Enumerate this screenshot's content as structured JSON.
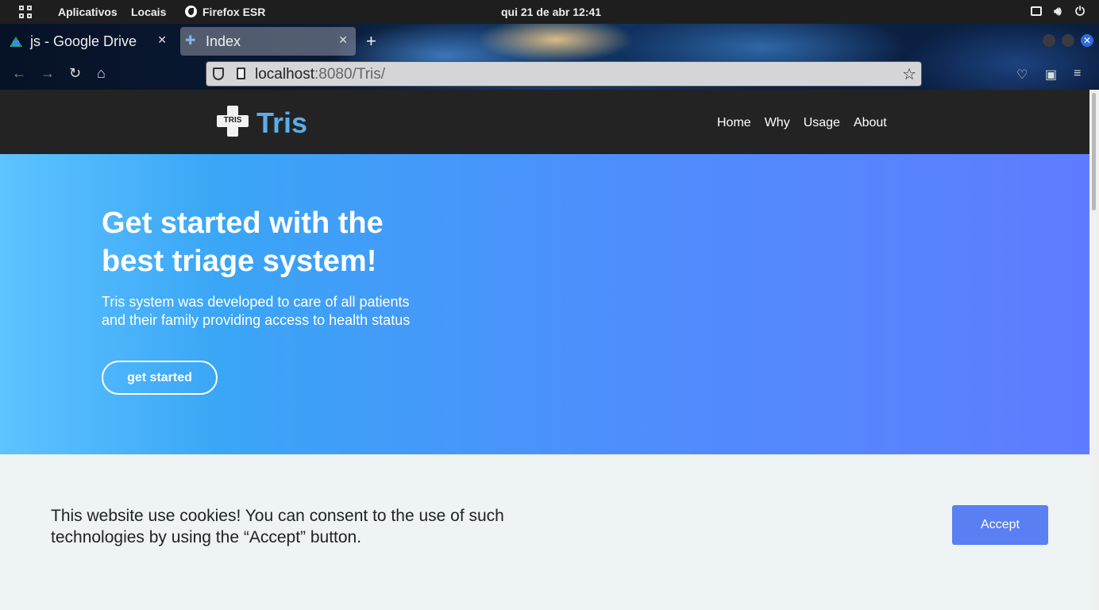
{
  "system_bar": {
    "apps_label": "Aplicativos",
    "places_label": "Locais",
    "app_name": "Firefox ESR",
    "clock": "qui 21 de abr  12:41"
  },
  "browser": {
    "tabs": [
      {
        "title": "js - Google Drive",
        "icon": "google-drive-icon"
      },
      {
        "title": "Index",
        "icon": "tris-favicon",
        "active": true
      }
    ],
    "url_host": "localhost",
    "url_rest": ":8080/Tris/"
  },
  "site": {
    "logo_text": "TRIS",
    "brand": "Tris",
    "nav": [
      "Home",
      "Why",
      "Usage",
      "About"
    ],
    "hero_title": "Get started with the best triage system!",
    "hero_text": "Tris system was developed to care of all patients and their family providing access to health status",
    "cta_label": "get started"
  },
  "cookie_banner": {
    "text": "This website use cookies! You can consent to the use of such technologies by using the “Accept” button.",
    "accept_label": "Accept"
  },
  "colors": {
    "accent": "#5a7ff2",
    "header_bg": "#232323",
    "brand": "#5aaee8"
  }
}
